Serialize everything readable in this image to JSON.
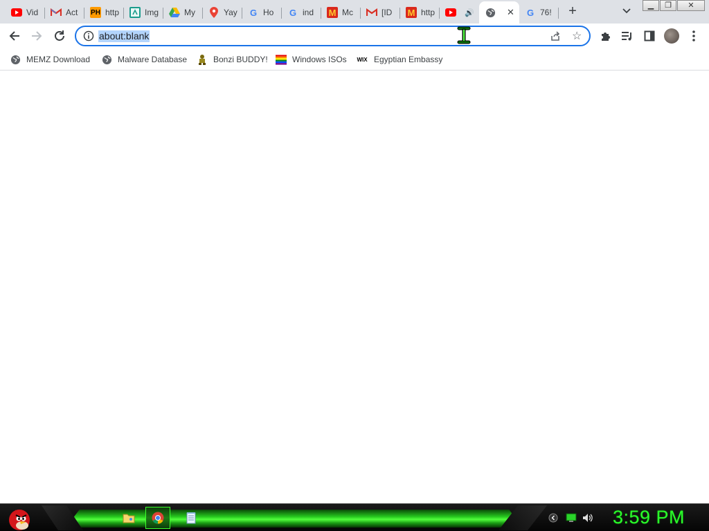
{
  "tabs": [
    {
      "title": "Vid",
      "favicon": "youtube-icon",
      "color": "#ff0000"
    },
    {
      "title": "Act",
      "favicon": "gmail-icon",
      "color": "#d93025"
    },
    {
      "title": "http",
      "favicon": "ph-icon",
      "color": "#ff9900",
      "favicon_text": "PH"
    },
    {
      "title": "Img",
      "favicon": "imgflip-icon",
      "color": "#1a9c8c"
    },
    {
      "title": "My",
      "favicon": "google-drive-icon",
      "color": "#34a853"
    },
    {
      "title": "Yay",
      "favicon": "google-maps-icon",
      "color": "#ea4335"
    },
    {
      "title": "Ho",
      "favicon": "google-icon",
      "color": "#4285f4",
      "favicon_text": "G"
    },
    {
      "title": "ind",
      "favicon": "google-icon",
      "color": "#4285f4",
      "favicon_text": "G"
    },
    {
      "title": "Mc",
      "favicon": "mcdonalds-icon",
      "color": "#da291c",
      "favicon_text": "M"
    },
    {
      "title": "[ID",
      "favicon": "gmail-icon",
      "color": "#d93025"
    },
    {
      "title": "http",
      "favicon": "mcdonalds-icon",
      "color": "#da291c",
      "favicon_text": "M"
    },
    {
      "title": "",
      "favicon": "youtube-icon",
      "color": "#ff0000",
      "audio": true
    },
    {
      "title": "",
      "favicon": "globe-icon",
      "color": "#5f6368",
      "active": true
    },
    {
      "title": "76!",
      "favicon": "google-icon",
      "color": "#4285f4",
      "favicon_text": "G"
    }
  ],
  "tab_strip": {
    "new_tab_label": "+",
    "close_glyph": "✕",
    "audio_glyph": "🔊"
  },
  "window_controls": {
    "minimize": "▁",
    "maximize": "❐",
    "close": "✕"
  },
  "omnibox": {
    "url": "about:blank",
    "selected": true
  },
  "bookmarks": [
    {
      "label": "MEMZ Download",
      "icon": "globe-icon"
    },
    {
      "label": "Malware Database",
      "icon": "globe-icon"
    },
    {
      "label": "Bonzi BUDDY!",
      "icon": "bonzi-icon"
    },
    {
      "label": "Windows ISOs",
      "icon": "rainbow-flag-icon"
    },
    {
      "label": "Egyptian Embassy",
      "icon": "wix-icon",
      "icon_text": "WIX"
    }
  ],
  "taskbar": {
    "clock": "3:59 PM",
    "apps": [
      {
        "name": "file-explorer-icon",
        "active": false
      },
      {
        "name": "chrome-icon",
        "active": true
      },
      {
        "name": "notepad-icon",
        "active": false
      }
    ]
  },
  "colors": {
    "accent": "#1a73e8",
    "selection": "#b3d4fc",
    "clock": "#2aff2a",
    "taskbar_glow": "#52ff3c"
  }
}
